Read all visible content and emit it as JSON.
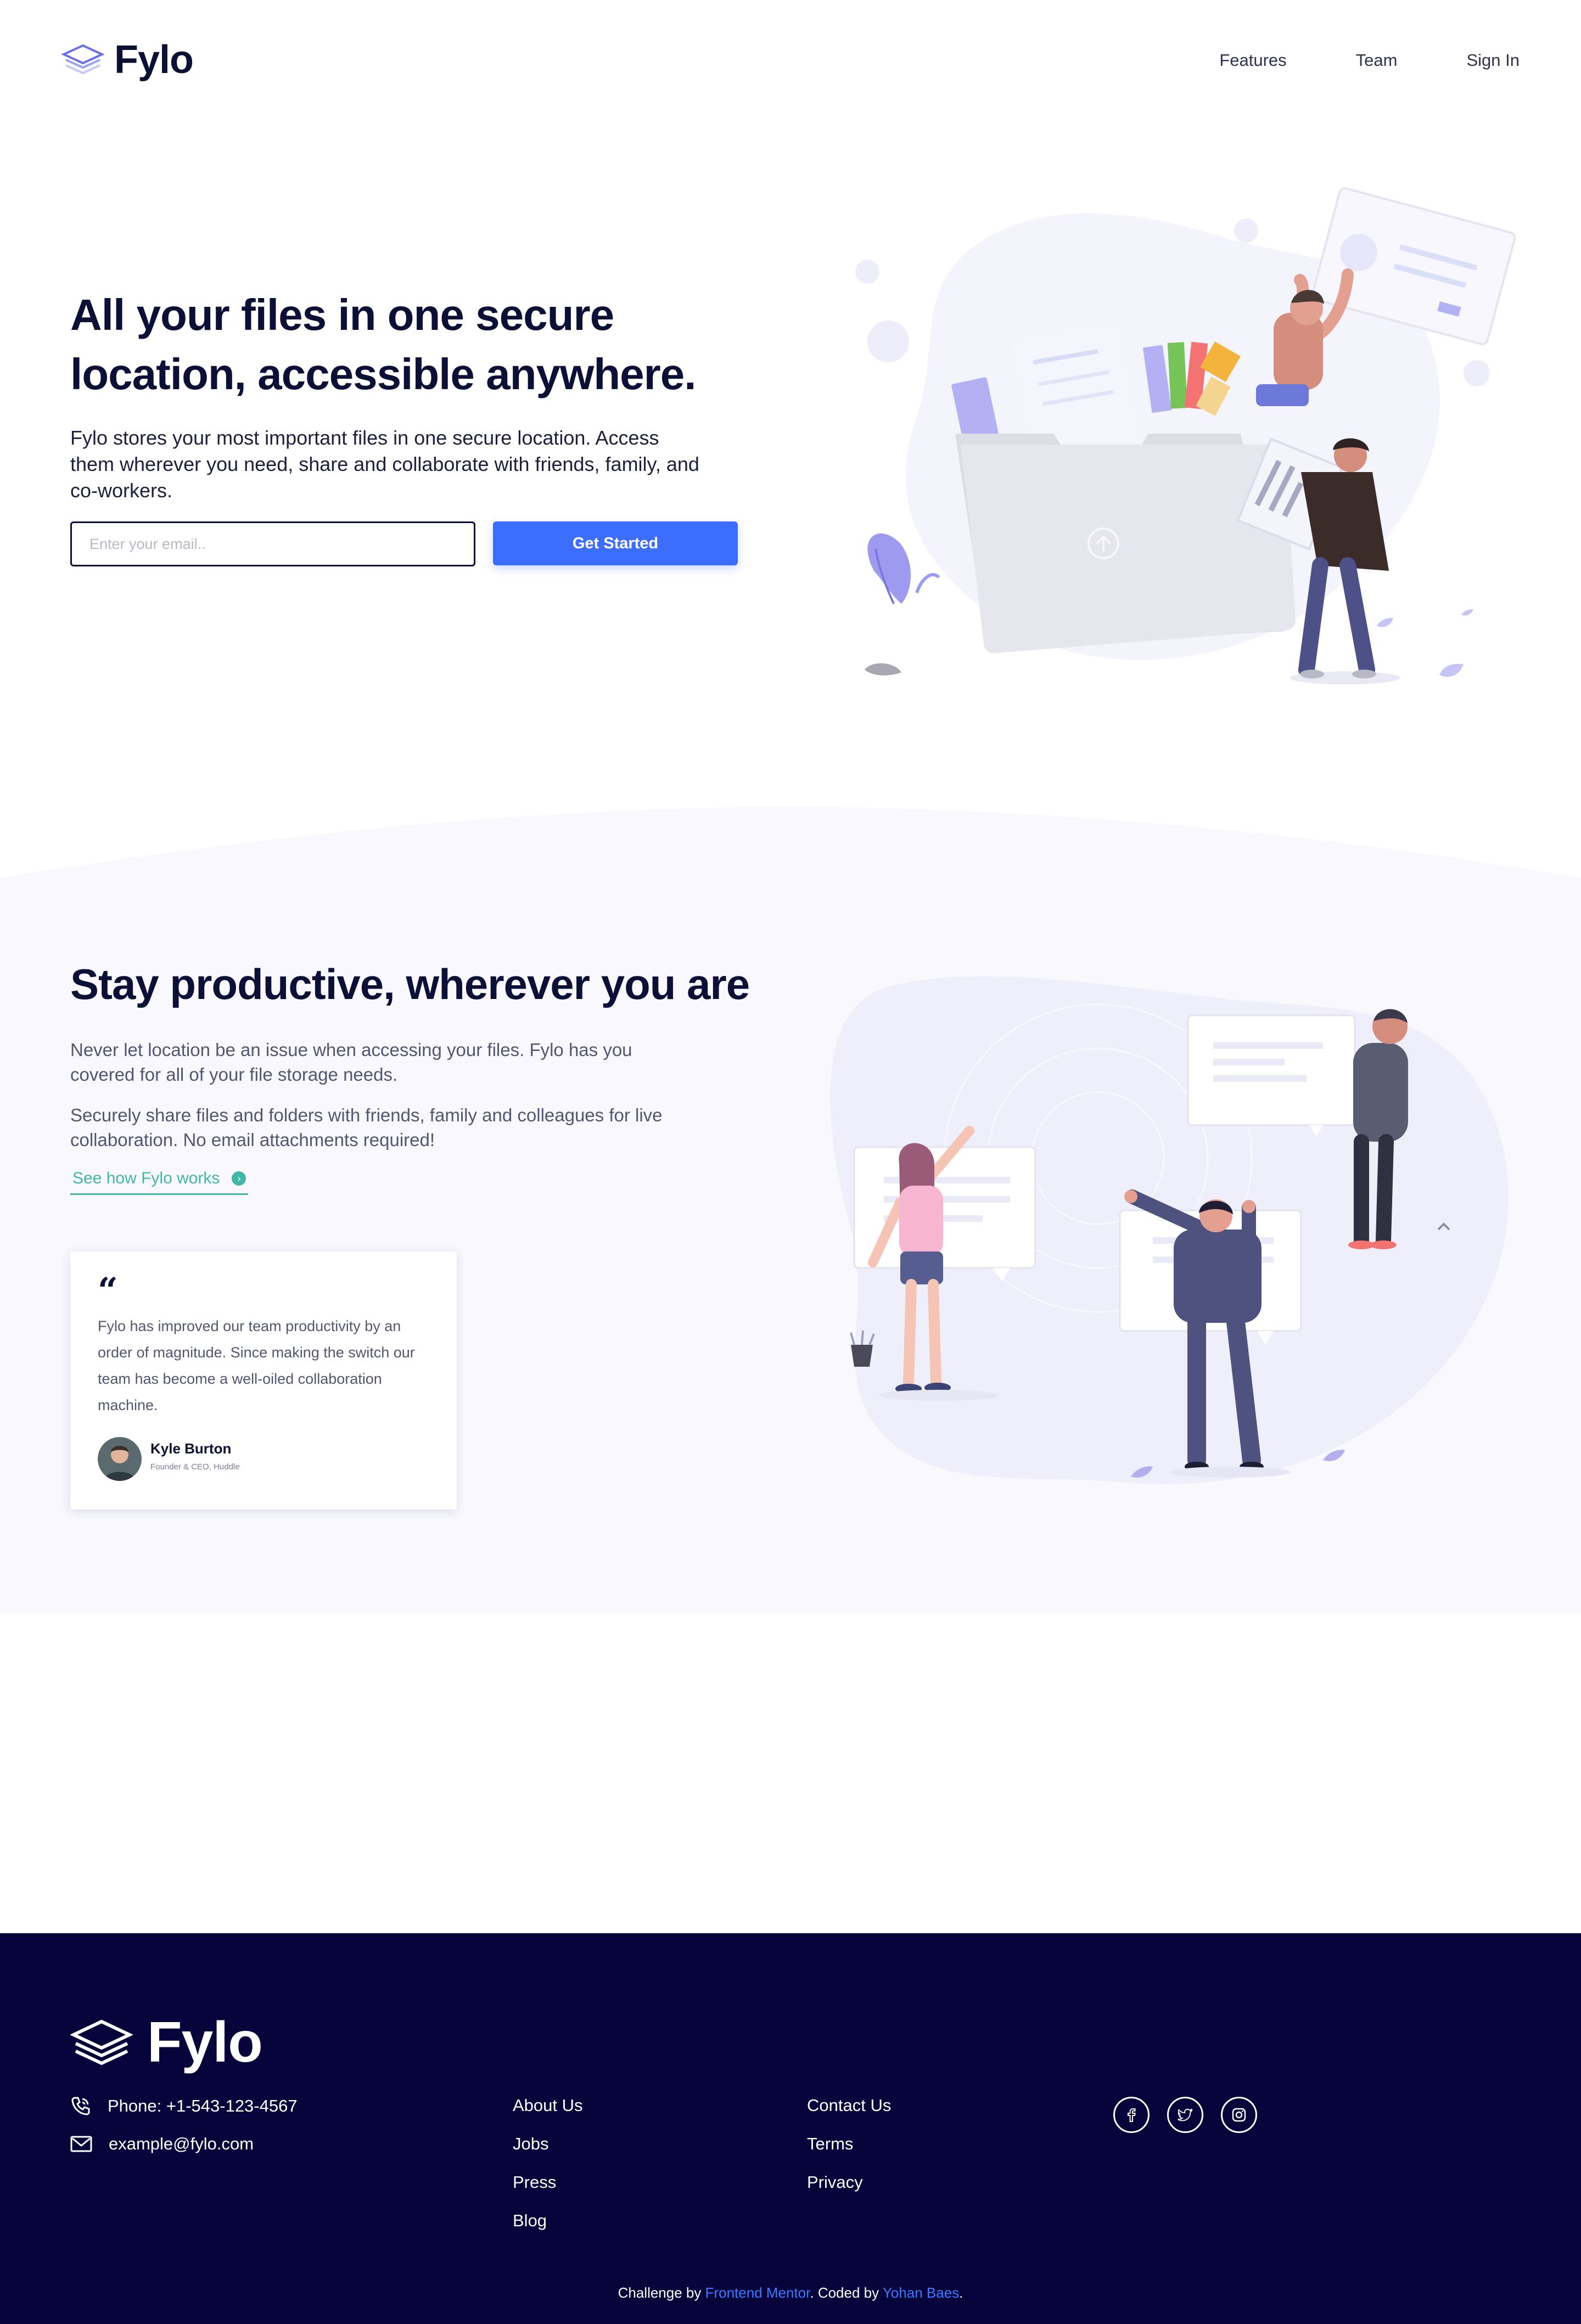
{
  "header": {
    "logo_text": "Fylo",
    "nav": [
      "Features",
      "Team",
      "Sign In"
    ]
  },
  "hero": {
    "title": "All your files in one secure location, accessible anywhere.",
    "text": "Fylo stores your most important files in one secure location. Access them wherever you need, share and collaborate with friends, family, and co-workers.",
    "email_placeholder": "Enter your email..",
    "cta_label": "Get Started"
  },
  "productive": {
    "title": "Stay productive, wherever you are",
    "paragraph_1": "Never let location be an issue when accessing your files. Fylo has you covered for all of your file storage needs.",
    "paragraph_2": "Securely share files and folders with friends, family and colleagues for live collaboration. No email attachments required!",
    "link_label": "See how Fylo works"
  },
  "testimonial": {
    "quote_mark": "“",
    "text": "Fylo has improved our team productivity by an order of magnitude. Since making the switch our team has become a well-oiled collaboration machine.",
    "name": "Kyle Burton",
    "role": "Founder & CEO, Huddle"
  },
  "footer": {
    "logo_text": "Fylo",
    "phone": "Phone: +1-543-123-4567",
    "email": "example@fylo.com",
    "links_col1": [
      "About Us",
      "Jobs",
      "Press",
      "Blog"
    ],
    "links_col2": [
      "Contact Us",
      "Terms",
      "Privacy"
    ],
    "socials": [
      "facebook-icon",
      "twitter-icon",
      "instagram-icon"
    ],
    "attribution": {
      "prefix": "Challenge by ",
      "link1": "Frontend Mentor",
      "middle": ". Coded by ",
      "link2": "Yohan Baes",
      "suffix": "."
    }
  },
  "colors": {
    "primary_blue": "#3b6eff",
    "teal": "#3fb6a6",
    "navy": "#07043b",
    "section_bg": "#f8f8fe"
  }
}
